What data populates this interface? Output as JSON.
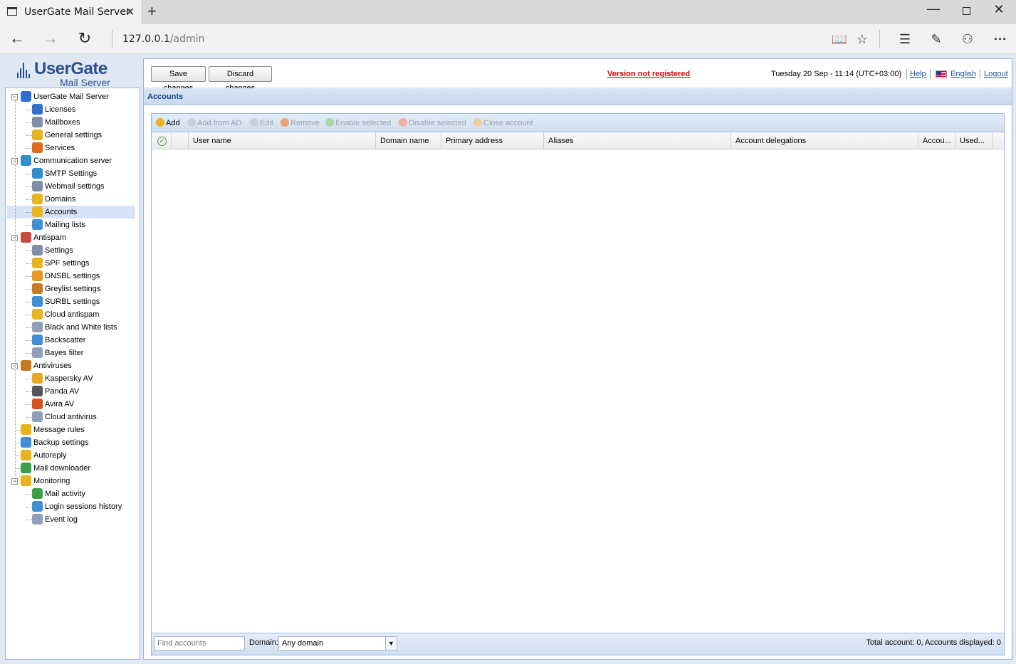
{
  "browser": {
    "tab_title": "UserGate Mail Server",
    "url_host": "127.0.0.1",
    "url_path": "/admin"
  },
  "logo": {
    "line1": "UserGate",
    "line2": "Mail Server"
  },
  "tree": [
    {
      "label": "UserGate Mail Server",
      "level": 0,
      "toggle": "−",
      "icon_color": "#2f6fcf",
      "icon": "server-icon"
    },
    {
      "label": "Licenses",
      "level": 1,
      "icon_color": "#2f6fcf",
      "icon": "info-icon"
    },
    {
      "label": "Mailboxes",
      "level": 1,
      "icon_color": "#7f8fa8",
      "icon": "mailbox-icon"
    },
    {
      "label": "General settings",
      "level": 1,
      "icon_color": "#e8b41e",
      "icon": "settings-icon"
    },
    {
      "label": "Services",
      "level": 1,
      "icon_color": "#e06a1a",
      "icon": "services-icon"
    },
    {
      "label": "Communication server",
      "level": 0,
      "toggle": "−",
      "icon_color": "#2f8fcf",
      "icon": "at-icon"
    },
    {
      "label": "SMTP Settings",
      "level": 1,
      "icon_color": "#2f8fcf",
      "icon": "smtp-icon"
    },
    {
      "label": "Webmail settings",
      "level": 1,
      "icon_color": "#7f8fa8",
      "icon": "webmail-icon"
    },
    {
      "label": "Domains",
      "level": 1,
      "icon_color": "#e8b41e",
      "icon": "domains-icon"
    },
    {
      "label": "Accounts",
      "level": 1,
      "icon_color": "#e8b41e",
      "icon": "accounts-icon",
      "selected": true
    },
    {
      "label": "Mailing lists",
      "level": 1,
      "icon_color": "#3d8fd8",
      "icon": "mailing-list-icon"
    },
    {
      "label": "Antispam",
      "level": 0,
      "toggle": "−",
      "icon_color": "#c84a3a",
      "icon": "antispam-icon"
    },
    {
      "label": "Settings",
      "level": 1,
      "icon_color": "#7f8fa8",
      "icon": "settings-icon"
    },
    {
      "label": "SPF settings",
      "level": 1,
      "icon_color": "#e8b41e",
      "icon": "spf-icon"
    },
    {
      "label": "DNSBL settings",
      "level": 1,
      "icon_color": "#e89a1e",
      "icon": "dnsbl-icon"
    },
    {
      "label": "Greylist settings",
      "level": 1,
      "icon_color": "#c8781e",
      "icon": "greylist-icon"
    },
    {
      "label": "SURBL settings",
      "level": 1,
      "icon_color": "#3d8fd8",
      "icon": "surbl-icon"
    },
    {
      "label": "Cloud antispam",
      "level": 1,
      "icon_color": "#e8b41e",
      "icon": "cloud-icon"
    },
    {
      "label": "Black and White lists",
      "level": 1,
      "icon_color": "#8f9fb8",
      "icon": "lists-icon"
    },
    {
      "label": "Backscatter",
      "level": 1,
      "icon_color": "#3d8fd8",
      "icon": "backscatter-icon"
    },
    {
      "label": "Bayes filter",
      "level": 1,
      "icon_color": "#8f9fb8",
      "icon": "filter-icon"
    },
    {
      "label": "Antiviruses",
      "level": 0,
      "toggle": "−",
      "icon_color": "#c8781e",
      "icon": "antivirus-icon"
    },
    {
      "label": "Kaspersky AV",
      "level": 1,
      "icon_color": "#e8a81e",
      "icon": "kaspersky-icon"
    },
    {
      "label": "Panda AV",
      "level": 1,
      "icon_color": "#555555",
      "icon": "panda-icon"
    },
    {
      "label": "Avira AV",
      "level": 1,
      "icon_color": "#d8501e",
      "icon": "avira-icon"
    },
    {
      "label": "Cloud antivirus",
      "level": 1,
      "icon_color": "#8f9fb8",
      "icon": "cloud-antivirus-icon"
    },
    {
      "label": "Message rules",
      "level": 0,
      "icon_color": "#e8b41e",
      "icon": "message-rules-icon"
    },
    {
      "label": "Backup settings",
      "level": 0,
      "icon_color": "#3d8fd8",
      "icon": "backup-icon"
    },
    {
      "label": "Autoreply",
      "level": 0,
      "icon_color": "#e8b41e",
      "icon": "autoreply-icon"
    },
    {
      "label": "Mail downloader",
      "level": 0,
      "icon_color": "#3d9f4a",
      "icon": "downloader-icon"
    },
    {
      "label": "Monitoring",
      "level": 0,
      "toggle": "−",
      "icon_color": "#e8b41e",
      "icon": "monitoring-icon"
    },
    {
      "label": "Mail activity",
      "level": 1,
      "icon_color": "#3d9f4a",
      "icon": "mail-activity-icon"
    },
    {
      "label": "Login sessions history",
      "level": 1,
      "icon_color": "#3d8fd8",
      "icon": "sessions-icon"
    },
    {
      "label": "Event log",
      "level": 1,
      "icon_color": "#8f9fb8",
      "icon": "event-log-icon"
    }
  ],
  "topbar": {
    "save_label": "Save changes",
    "discard_label": "Discard changes",
    "not_registered": "Version not registered",
    "datetime": "Tuesday 20 Sep - 11:14 (UTC+03:00)",
    "help": "Help",
    "language": "English",
    "logout": "Logout"
  },
  "section_title": "Accounts",
  "toolbar": [
    {
      "label": "Add",
      "enabled": true,
      "icon_color": "#e8b41e",
      "icon": "add-user-icon"
    },
    {
      "label": "Add from AD",
      "enabled": false,
      "icon_color": "#c8d0da",
      "icon": "add-ad-icon"
    },
    {
      "label": "Edit",
      "enabled": false,
      "icon_color": "#c8d0da",
      "icon": "edit-icon"
    },
    {
      "label": "Remove",
      "enabled": false,
      "icon_color": "#f0a070",
      "icon": "remove-icon"
    },
    {
      "label": "Enable selected",
      "enabled": false,
      "icon_color": "#a8d8a8",
      "icon": "enable-icon"
    },
    {
      "label": "Disable selected",
      "enabled": false,
      "icon_color": "#f0b0a0",
      "icon": "disable-icon"
    },
    {
      "label": "Close account",
      "enabled": false,
      "icon_color": "#e8d0a0",
      "icon": "close-account-icon"
    }
  ],
  "columns": [
    "User name",
    "Domain name",
    "Primary address",
    "Aliases",
    "Account delegations",
    "Accou...",
    "Used..."
  ],
  "rows": [],
  "footer": {
    "search_placeholder": "Find accounts",
    "domain_label": "Domain:",
    "domain_value": "Any domain",
    "total_text": "Total account: 0, Accounts displayed: 0"
  },
  "colors": {
    "accent": "#15428b",
    "warning": "#e10000",
    "link": "#1f4fa3",
    "selection": "#d7e4f5"
  }
}
